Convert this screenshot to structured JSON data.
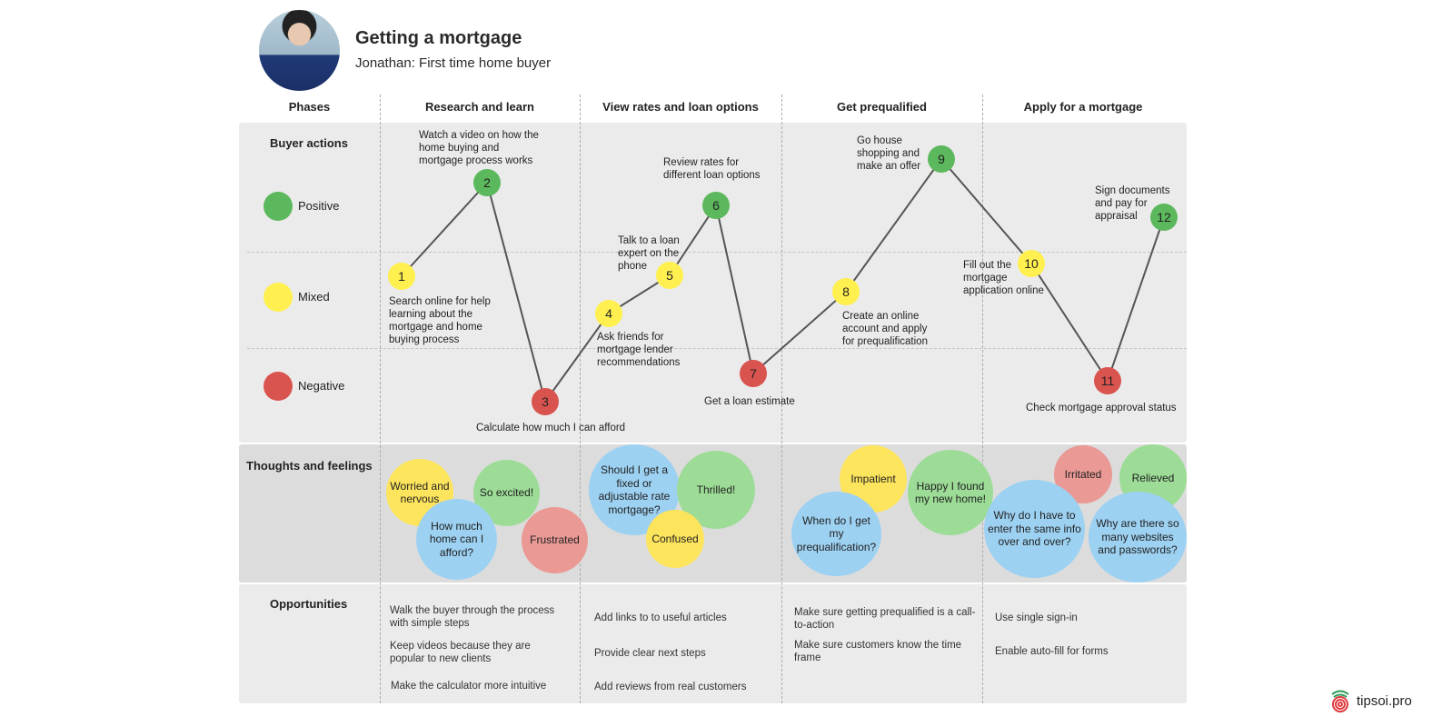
{
  "header": {
    "title": "Getting a mortgage",
    "subtitle": "Jonathan: First time home buyer",
    "avatar": "persona-photo"
  },
  "phases_label": "Phases",
  "phases": [
    "Research and learn",
    "View rates and loan options",
    "Get prequalified",
    "Apply for a mortgage"
  ],
  "rows": {
    "buyer_actions": "Buyer actions",
    "thoughts": "Thoughts and feelings",
    "opportunities": "Opportunities"
  },
  "legend": [
    {
      "label": "Positive",
      "color": "#5cb85c"
    },
    {
      "label": "Mixed",
      "color": "#fff04f"
    },
    {
      "label": "Negative",
      "color": "#d9534f"
    }
  ],
  "colors": {
    "positive": "#5cb85c",
    "mixed": "#fff04f",
    "negative": "#d9534f",
    "bubble_blue": "#9dd1f2",
    "bubble_green": "#9cdc96",
    "bubble_yellow": "#fde45d",
    "bubble_red": "#ea9994",
    "line": "#555555"
  },
  "steps": [
    {
      "n": "1",
      "sentiment": "mixed",
      "text": "Search online for help learning about the mortgage and home buying process"
    },
    {
      "n": "2",
      "sentiment": "positive",
      "text": "Watch a video on how the home buying and mortgage process works"
    },
    {
      "n": "3",
      "sentiment": "negative",
      "text": "Calculate how much I can afford"
    },
    {
      "n": "4",
      "sentiment": "mixed",
      "text": "Ask friends for mortgage lender recommendations"
    },
    {
      "n": "5",
      "sentiment": "mixed",
      "text": "Talk to a loan expert on the phone"
    },
    {
      "n": "6",
      "sentiment": "positive",
      "text": "Review rates for different loan options"
    },
    {
      "n": "7",
      "sentiment": "negative",
      "text": "Get a loan estimate"
    },
    {
      "n": "8",
      "sentiment": "mixed",
      "text": "Create an online account and apply for prequalification"
    },
    {
      "n": "9",
      "sentiment": "positive",
      "text": "Go house shopping and make an offer"
    },
    {
      "n": "10",
      "sentiment": "mixed",
      "text": "Fill out the mortgage application online"
    },
    {
      "n": "11",
      "sentiment": "negative",
      "text": "Check mortgage approval status"
    },
    {
      "n": "12",
      "sentiment": "positive",
      "text": "Sign documents and pay for appraisal"
    }
  ],
  "thoughts": [
    {
      "text": "Worried and nervous",
      "color": "yellow"
    },
    {
      "text": "So excited!",
      "color": "green"
    },
    {
      "text": "How much home can I afford?",
      "color": "blue"
    },
    {
      "text": "Frustrated",
      "color": "red"
    },
    {
      "text": "Should I get a fixed or adjustable rate mortgage?",
      "color": "blue"
    },
    {
      "text": "Thrilled!",
      "color": "green"
    },
    {
      "text": "Confused",
      "color": "yellow"
    },
    {
      "text": "Impatient",
      "color": "yellow"
    },
    {
      "text": "Happy I found my new home!",
      "color": "green"
    },
    {
      "text": "When do I get my prequalification?",
      "color": "blue"
    },
    {
      "text": "Irritated",
      "color": "red"
    },
    {
      "text": "Relieved",
      "color": "green"
    },
    {
      "text": "Why do I have to enter the same info over and over?",
      "color": "blue"
    },
    {
      "text": "Why are there so many websites and passwords?",
      "color": "blue"
    }
  ],
  "opportunities": [
    [
      "Walk the buyer through the process with simple steps",
      "Keep videos because they are popular to new clients",
      "Make the calculator more intuitive"
    ],
    [
      "Add links to to useful articles",
      "Provide clear next steps",
      "Add reviews from real customers"
    ],
    [
      "Make sure getting prequalified is a call-to-action",
      "Make sure customers know the time frame"
    ],
    [
      "Use single sign-in",
      "Enable auto-fill for forms"
    ]
  ],
  "brand": {
    "name": "tipsoi.pro",
    "icon": "fingerprint-icon"
  }
}
